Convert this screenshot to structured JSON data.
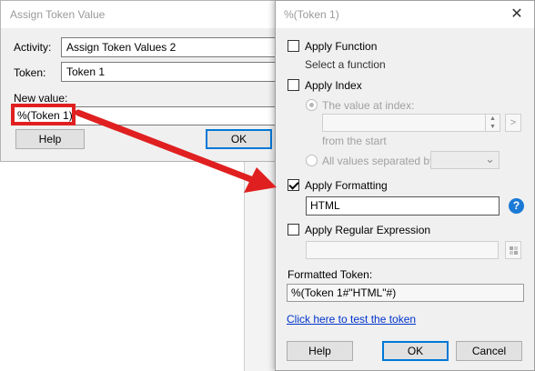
{
  "back_dialog": {
    "title": "Assign Token Value",
    "activity_label": "Activity:",
    "activity_value": "Assign Token Values 2",
    "token_label": "Token:",
    "token_value": "Token 1",
    "new_value_label": "New value:",
    "new_value": "%(Token 1)",
    "help_label": "Help",
    "ok_label": "OK"
  },
  "front_dialog": {
    "title": "%(Token 1)",
    "apply_function_label": "Apply Function",
    "select_function_text": "Select a function",
    "apply_index_label": "Apply Index",
    "value_at_index_label": "The value at index:",
    "from_the_start_text": "from the  start",
    "all_values_label": "All values separated by:",
    "apply_formatting_label": "Apply Formatting",
    "formatting_value": "HTML",
    "apply_regex_label": "Apply Regular Expression",
    "formatted_token_label": "Formatted Token:",
    "formatted_token_value": "%(Token 1#\"HTML\"#)",
    "test_link": "Click here to test the token",
    "help_label": "Help",
    "ok_label": "OK",
    "cancel_label": "Cancel",
    "checks": {
      "apply_function": false,
      "apply_index": false,
      "apply_formatting": true,
      "apply_regex": false
    }
  },
  "icons": {
    "close": "close-icon",
    "help": "help-circle-icon",
    "spin_up": "spin-up-icon",
    "spin_down": "spin-down-icon",
    "chevron_down": "chevron-down-icon",
    "arrow_right": "arrow-right-icon"
  },
  "glyphs": {
    "close": "✕",
    "help": "?",
    "next": ">",
    "chevron": "⌄"
  },
  "colors": {
    "annotation_red": "#e02020",
    "link_blue": "#0033cc",
    "help_blue": "#1a7ad6"
  }
}
